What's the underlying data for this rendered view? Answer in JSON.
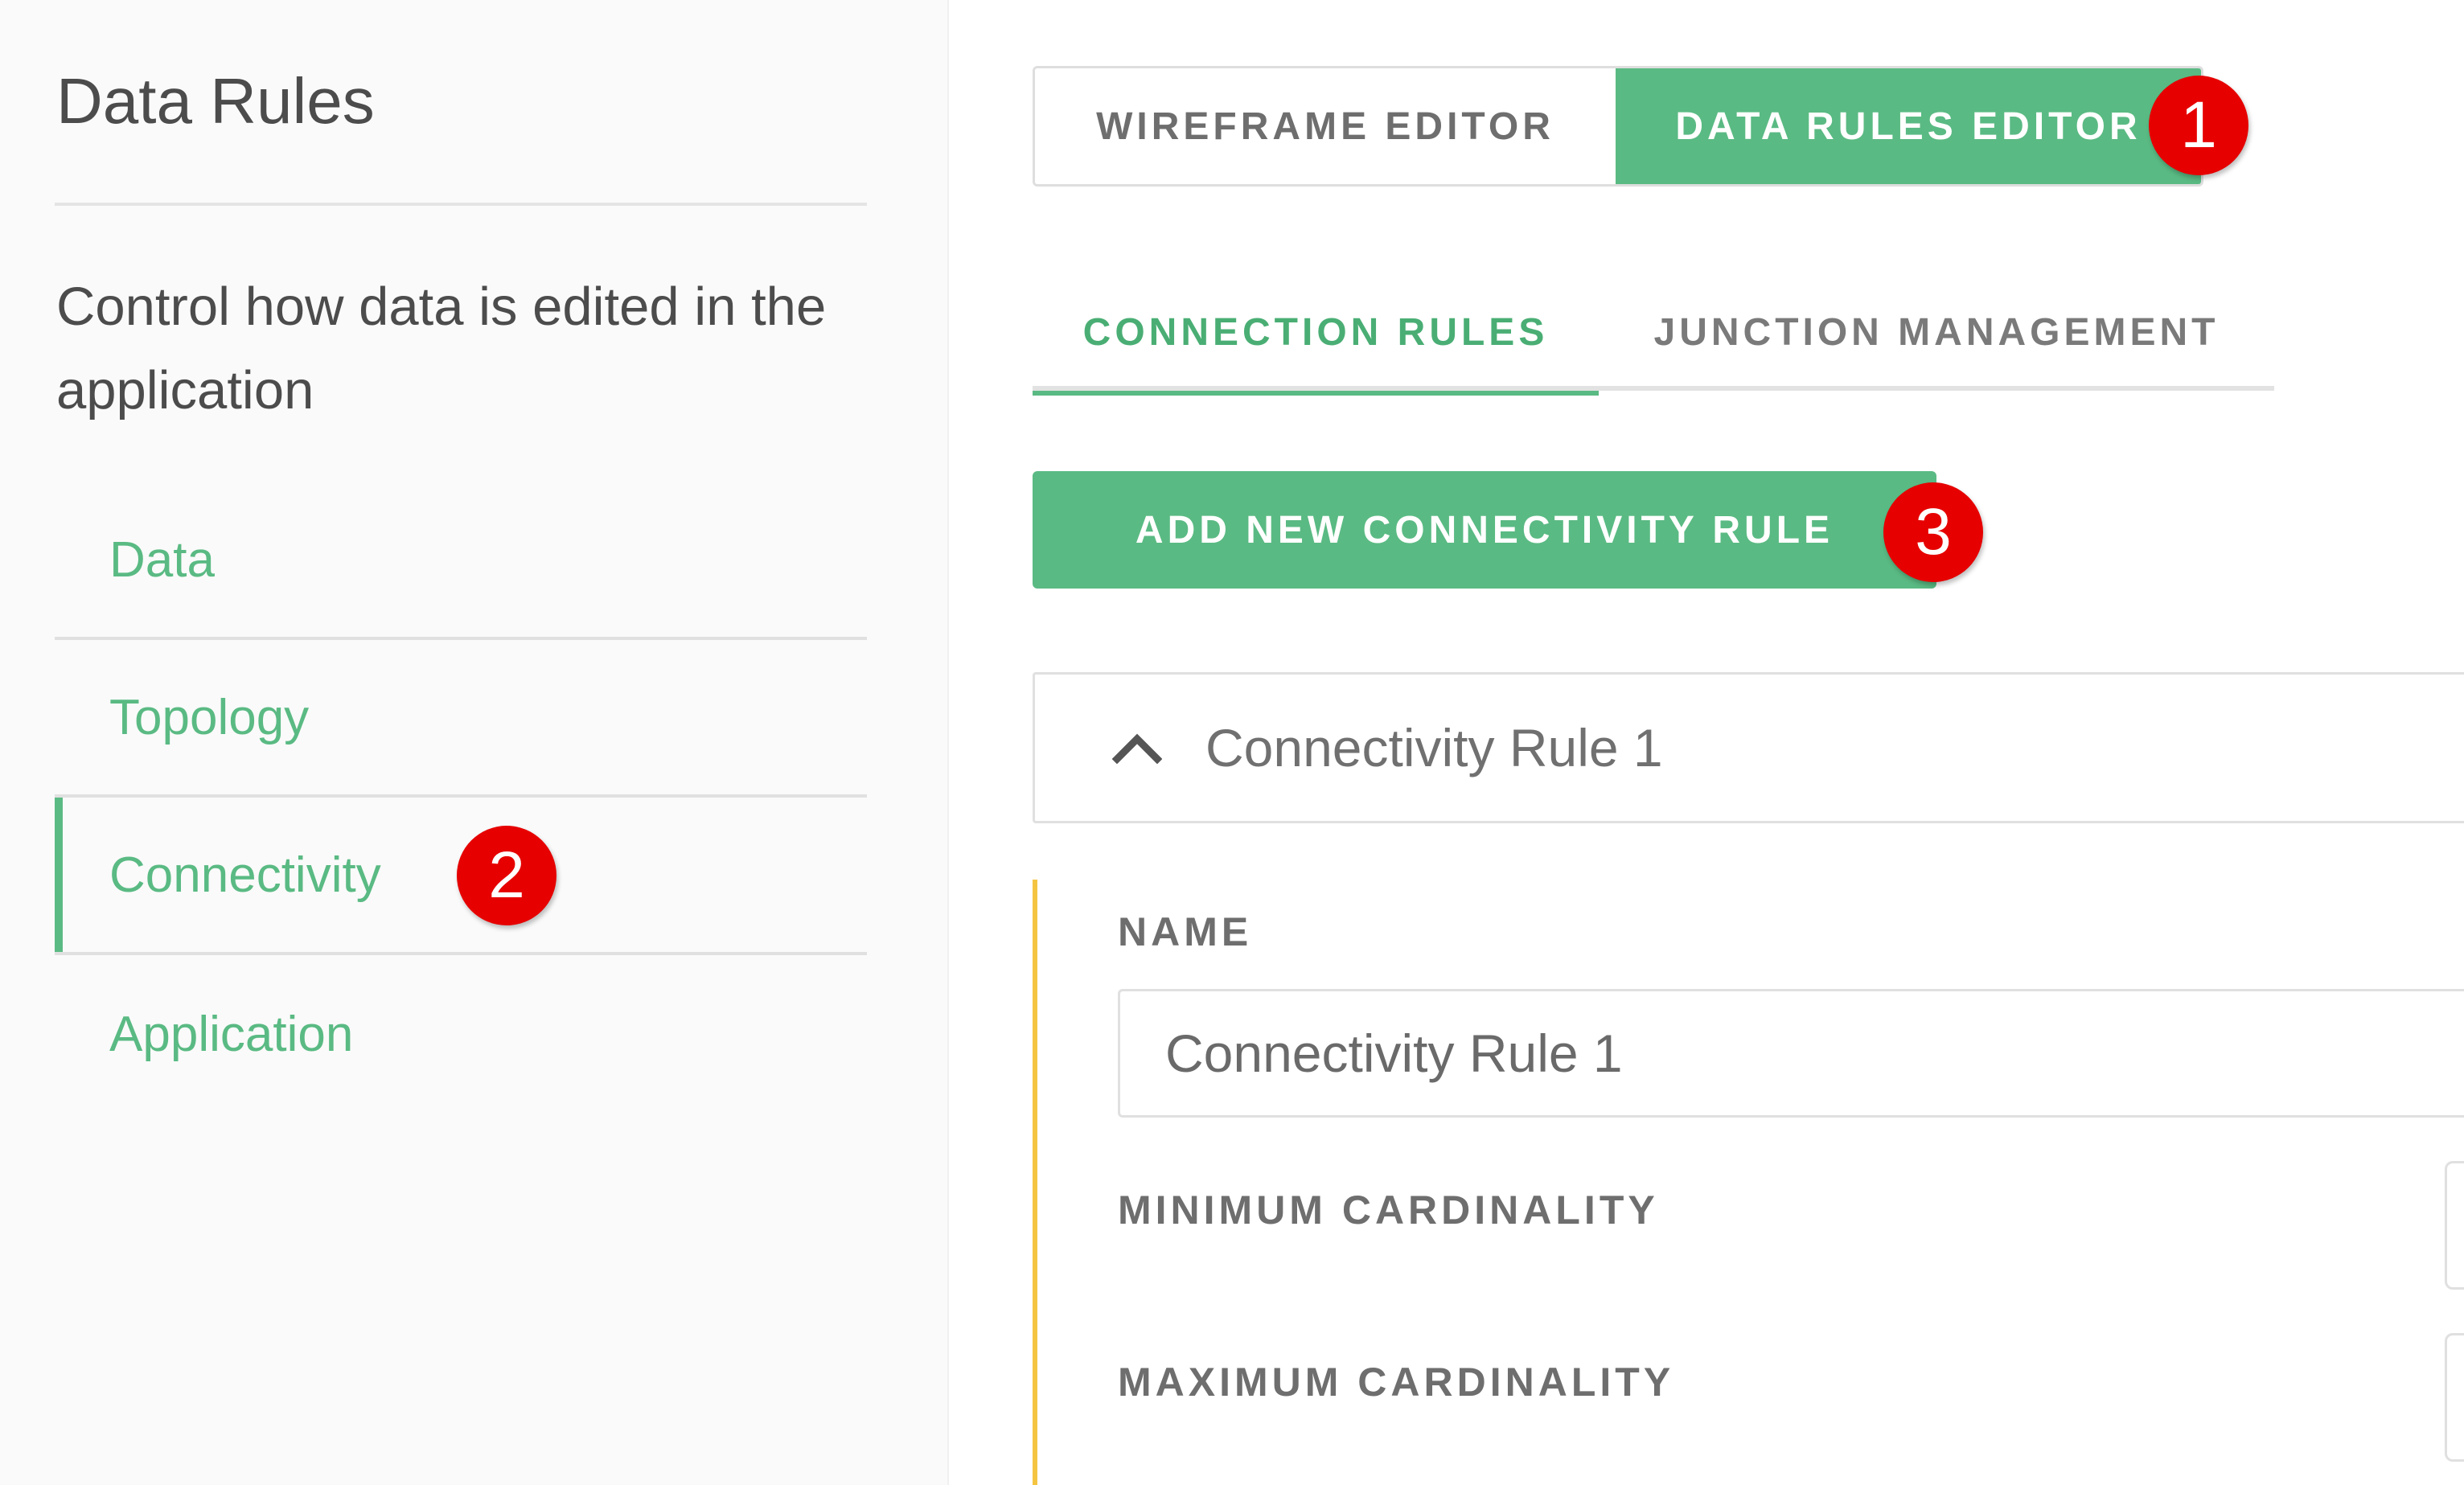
{
  "sidebar": {
    "title": "Data Rules",
    "description": "Control how data is edited in the application",
    "items": [
      {
        "label": "Data"
      },
      {
        "label": "Topology"
      },
      {
        "label": "Connectivity",
        "active": true
      },
      {
        "label": "Application"
      }
    ]
  },
  "editor_toggle": {
    "wireframe_label": "WIREFRAME EDITOR",
    "data_rules_label": "DATA RULES EDITOR"
  },
  "subtabs": {
    "connection_label": "CONNECTION RULES",
    "junction_label": "JUNCTION MANAGEMENT"
  },
  "add_rule_label": "ADD NEW CONNECTIVITY RULE",
  "rule": {
    "title": "Connectivity Rule 1",
    "name_label": "NAME",
    "name_value": "Connectivity Rule 1",
    "min_cardinality_label": "MINIMUM CARDINALITY",
    "max_cardinality_label": "MAXIMUM CARDINALITY"
  },
  "callouts": [
    "1",
    "2",
    "3"
  ],
  "colors": {
    "accent_green": "#5aba83",
    "callout_red": "#e60000",
    "rule_accent_yellow": "#f5c542"
  }
}
